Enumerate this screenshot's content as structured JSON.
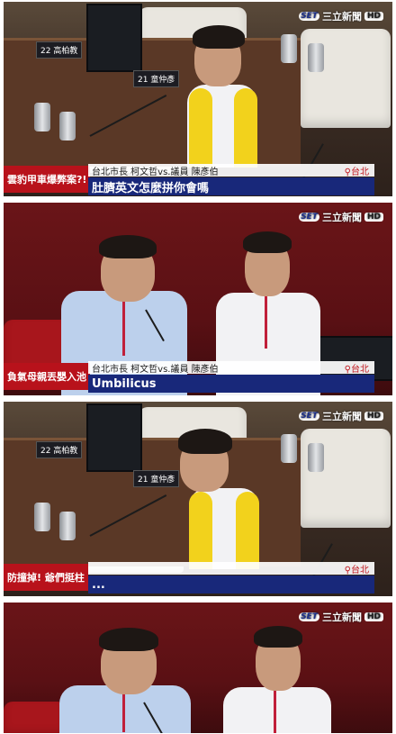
{
  "logo": {
    "set": "SET",
    "channel": "三立新聞",
    "hd": "HD"
  },
  "panels": [
    {
      "badge": "雲豹甲車爆弊案?!",
      "info": "台北市長 柯文哲vs.議員 陳彥伯",
      "location": "台北",
      "subtitle": "肚臍英文怎麼拼你會嗎",
      "nameplates": [
        "22 高柏教",
        "21 童仲彥"
      ]
    },
    {
      "badge": "負氣母親丟嬰入池",
      "info": "台北市長 柯文哲vs.議員 陳彥伯",
      "location": "台北",
      "subtitle": "Umbilicus",
      "nameplates": []
    },
    {
      "badge": "防撞掉! 爺們挺柱",
      "info": "",
      "location": "台北",
      "subtitle": "...",
      "nameplates": [
        "22 高柏教",
        "21 童仲彥"
      ]
    },
    {
      "badge": "",
      "info": "",
      "location": "",
      "subtitle": "",
      "nameplates": []
    }
  ]
}
